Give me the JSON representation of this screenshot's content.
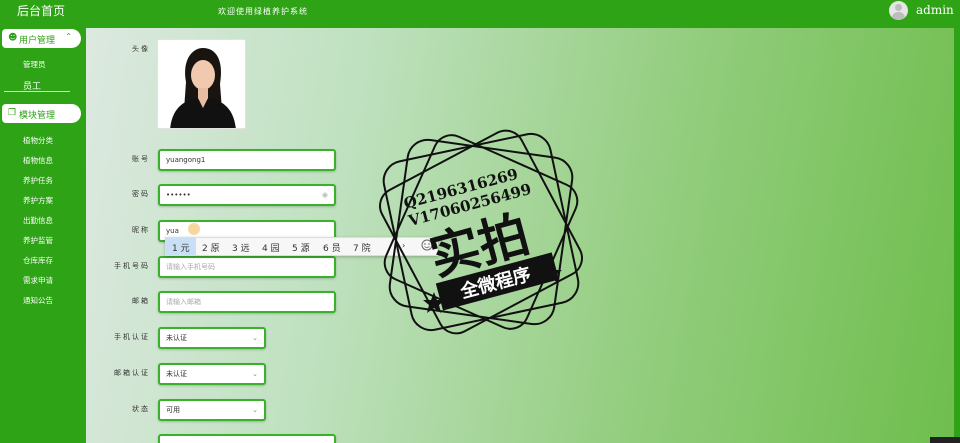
{
  "header": {
    "brand": "后台首页",
    "welcome": "欢迎使用绿植养护系统",
    "username": "admin"
  },
  "sidebar": {
    "groups": [
      {
        "label": "用户管理",
        "icon": "user-icon",
        "expanded": true,
        "items": [
          "管理员",
          "员工"
        ]
      },
      {
        "label": "模块管理",
        "icon": "module-icon",
        "expanded": true,
        "items": [
          "植物分类",
          "植物信息",
          "养护任务",
          "养护方案",
          "出勤信息",
          "养护监管",
          "仓库库存",
          "需求申请",
          "通知公告"
        ]
      }
    ]
  },
  "form": {
    "avatar_label": "头像",
    "account_label": "账号",
    "account_value": "yuangong1",
    "password_label": "密码",
    "password_value": "••••••",
    "nickname_label": "昵称",
    "nickname_value": "yua",
    "phone_label": "手机号码",
    "phone_placeholder": "请输入手机号码",
    "email_label": "邮箱",
    "email_placeholder": "请输入邮箱",
    "phone_verify_label": "手机认证",
    "phone_verify_value": "未认证",
    "email_verify_label": "邮箱认证",
    "email_verify_value": "未认证",
    "status_label": "状态",
    "status_value": "可用"
  },
  "ime": {
    "candidates": [
      "1 元",
      "2 原",
      "3 远",
      "4 园",
      "5 源",
      "6 员",
      "7 院"
    ],
    "next": "›"
  },
  "watermark": {
    "line1": "Q2196316269",
    "line2": "V17060256499",
    "big": "实拍",
    "banner": "全微程序"
  },
  "colors": {
    "brand_green": "#2ea316",
    "field_border": "#39b12a"
  }
}
